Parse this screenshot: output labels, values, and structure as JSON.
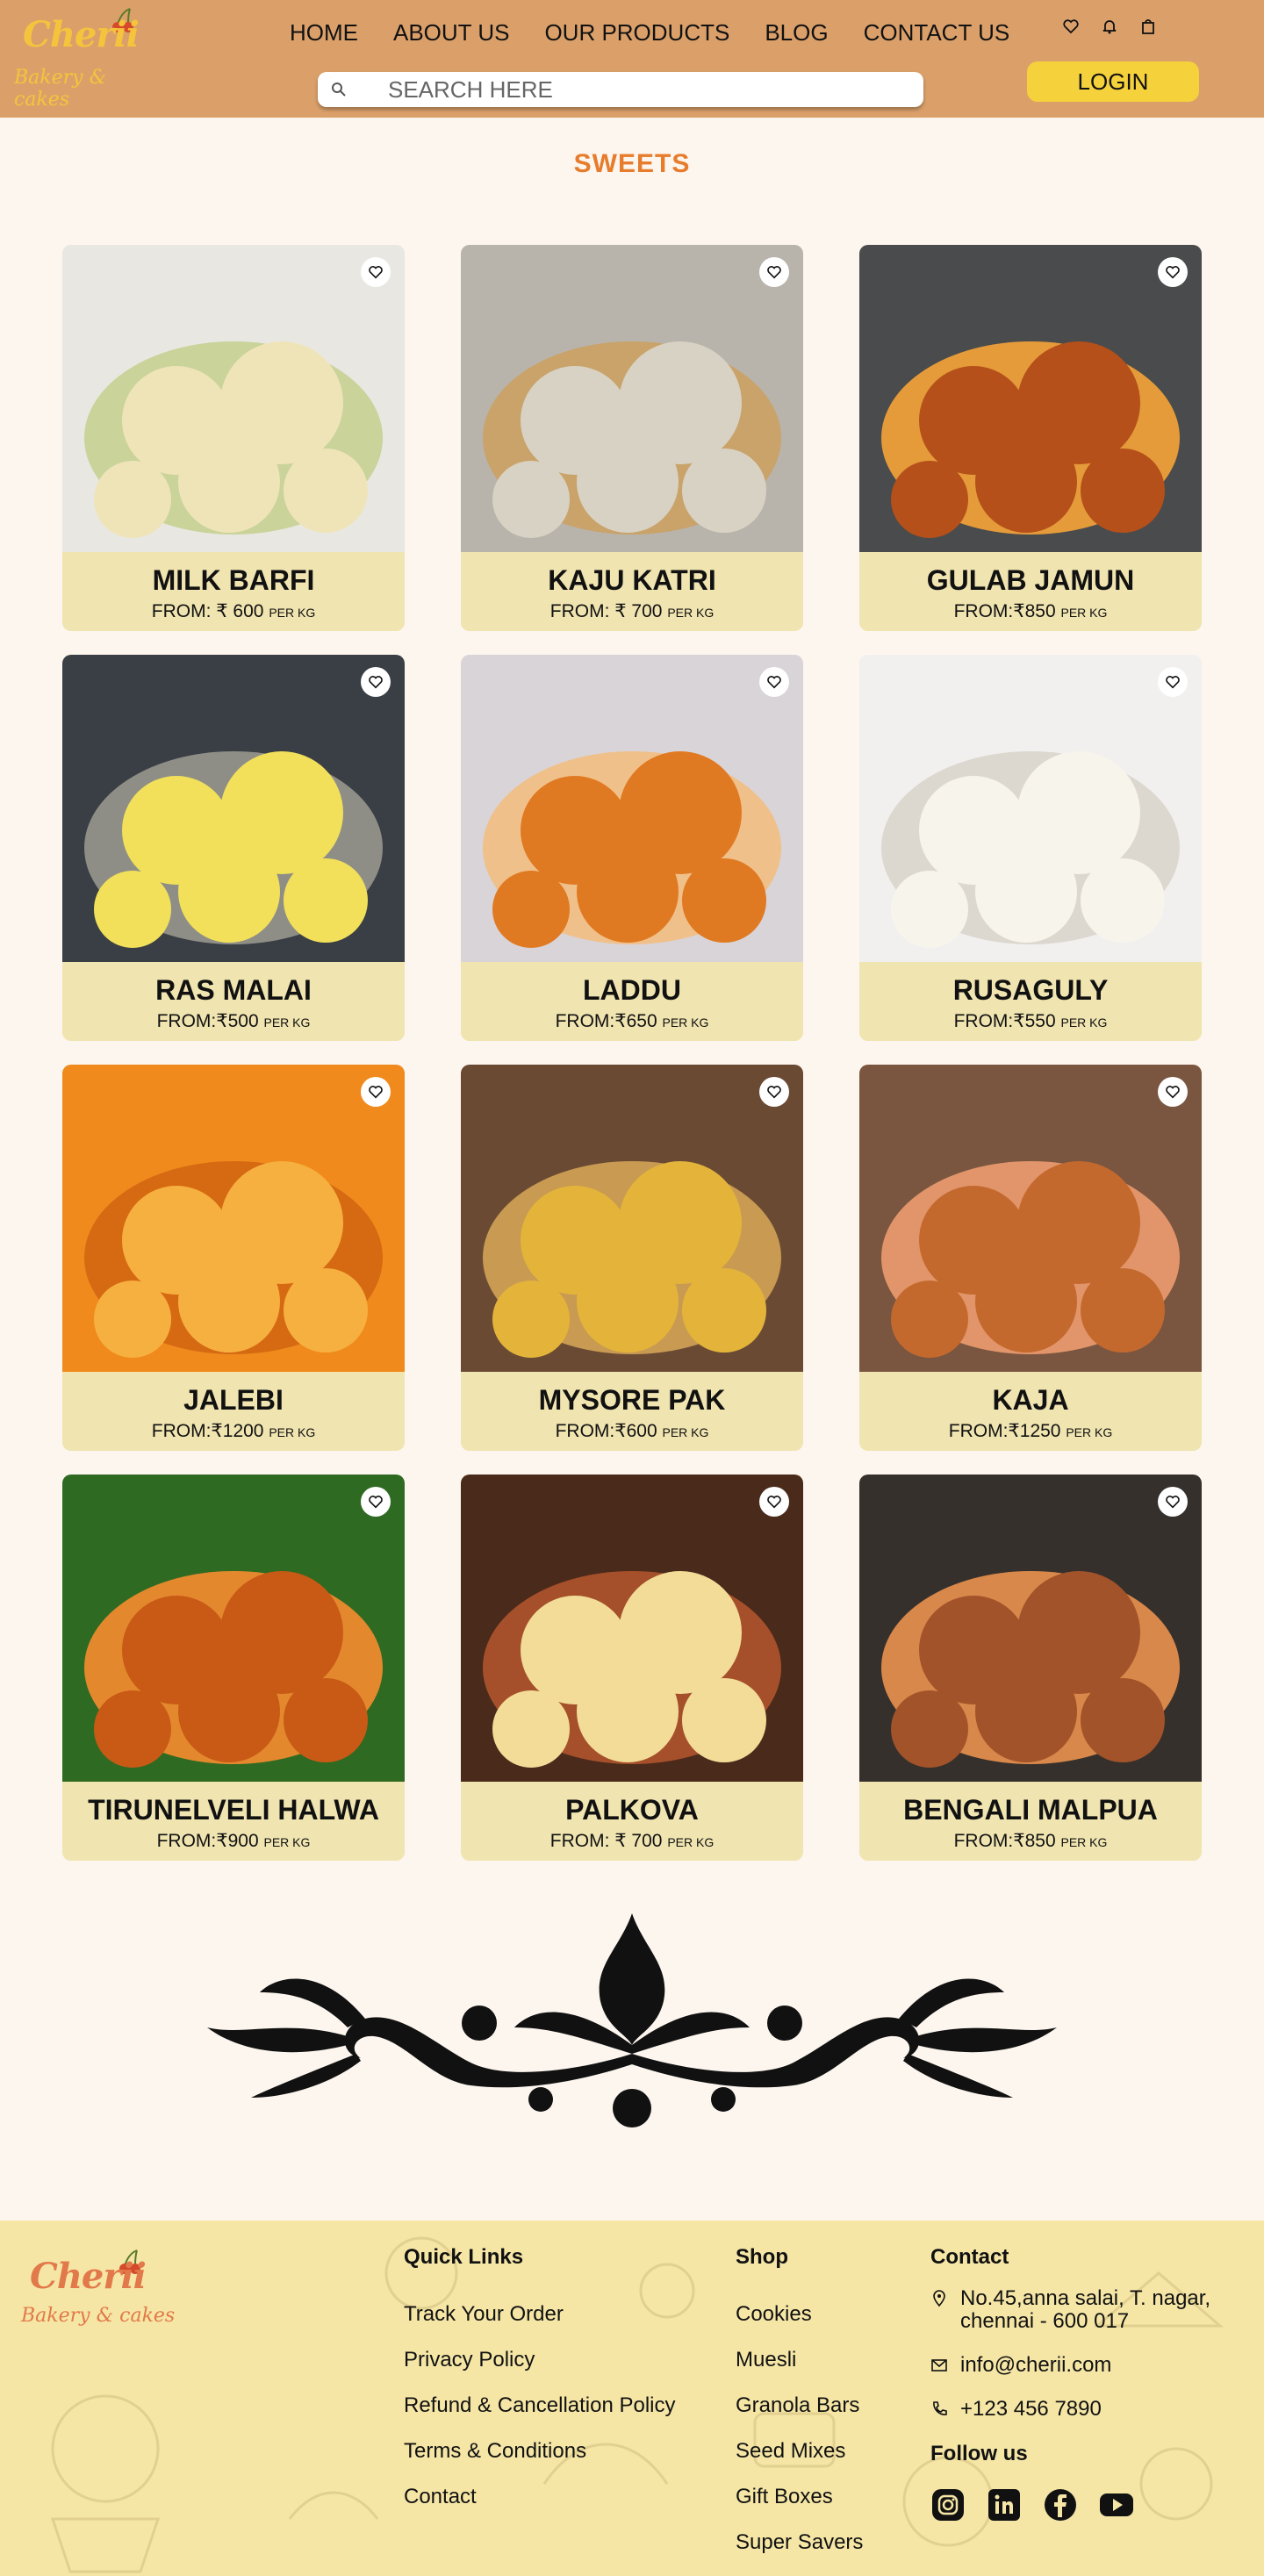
{
  "brand": {
    "name": "Cherii",
    "tagline": "Bakery & cakes"
  },
  "nav": {
    "items": [
      "HOME",
      "ABOUT US",
      "OUR PRODUCTS",
      "BLOG",
      "CONTACT US"
    ]
  },
  "search": {
    "placeholder": "SEARCH HERE"
  },
  "header_icons": [
    "heart-icon",
    "bell-icon",
    "shopping-bag-icon"
  ],
  "login_label": "LOGIN",
  "section_title": "SWEETS",
  "products": [
    {
      "name": "MILK BARFI",
      "price": "FROM:  ₹  600",
      "unit": "PER KG"
    },
    {
      "name": "KAJU KATRI",
      "price": "FROM:  ₹  700",
      "unit": "PER KG"
    },
    {
      "name": "GULAB JAMUN",
      "price": "FROM:₹850",
      "unit": "PER KG"
    },
    {
      "name": "RAS MALAI",
      "price": "FROM:₹500",
      "unit": "PER KG"
    },
    {
      "name": "LADDU",
      "price": "FROM:₹650",
      "unit": "PER KG"
    },
    {
      "name": "RUSAGULY",
      "price": "FROM:₹550",
      "unit": "PER KG"
    },
    {
      "name": "JALEBI",
      "price": "FROM:₹1200",
      "unit": "PER KG"
    },
    {
      "name": "MYSORE PAK",
      "price": "FROM:₹600",
      "unit": "PER KG"
    },
    {
      "name": "KAJA",
      "price": "FROM:₹1250",
      "unit": "PER KG"
    },
    {
      "name": "TIRUNELVELI  HALWA",
      "price": "FROM:₹900",
      "unit": "PER KG"
    },
    {
      "name": "PALKOVA",
      "price": "FROM:  ₹ 700",
      "unit": "PER KG"
    },
    {
      "name": "BENGALI MALPUA",
      "price": "FROM:₹850",
      "unit": "PER KG"
    }
  ],
  "footer": {
    "quick_links": {
      "title": "Quick Links",
      "items": [
        "Track Your Order",
        "Privacy Policy",
        "Refund & Cancellation Policy",
        "Terms & Conditions",
        "Contact"
      ]
    },
    "shop": {
      "title": "Shop",
      "items": [
        "Cookies",
        "Muesli",
        "Granola Bars",
        "Seed Mixes",
        "Gift Boxes",
        "Super Savers"
      ]
    },
    "contact": {
      "title": "Contact",
      "address": "No.45,anna salai, T. nagar, chennai - 600 017",
      "email": "info@cherii.com",
      "phone": "+123 456 7890",
      "follow": "Follow us",
      "socials": [
        "instagram-icon",
        "linkedin-icon",
        "facebook-icon",
        "youtube-icon"
      ]
    }
  },
  "colors": {
    "header_bg": "#dba06a",
    "accent": "#e67c2c",
    "login_bg": "#f5d13c",
    "card_info_bg": "#f0e4b0",
    "footer_bg": "#f5e6a6"
  }
}
